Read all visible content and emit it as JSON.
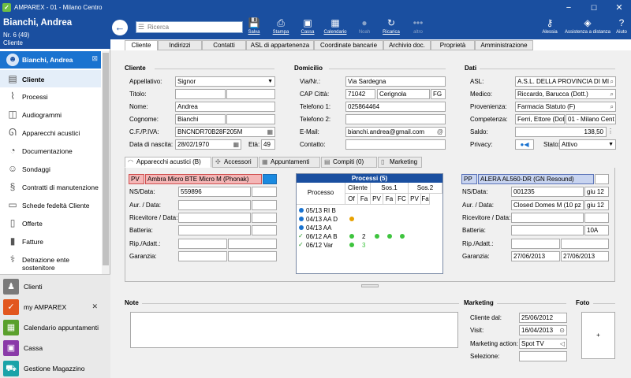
{
  "window": {
    "title": "AMPAREX - 01 - Milano Centro",
    "minimize": "−",
    "maximize": "☐",
    "close": "✕"
  },
  "patient": {
    "name": "Bianchi, Andrea",
    "number": "Nr. 6 (49)",
    "type": "Cliente"
  },
  "left_nav": {
    "header": "Bianchi, Andrea",
    "items": [
      {
        "label": "Cliente",
        "icon": "person-card-icon",
        "active": true
      },
      {
        "label": "Processi",
        "icon": "paperclip-icon"
      },
      {
        "label": "Audiogrammi",
        "icon": "audiogram-icon"
      },
      {
        "label": "Apparecchi acustici",
        "icon": "hearing-aid-icon"
      },
      {
        "label": "Documentazione",
        "icon": "document-icon"
      },
      {
        "label": "Sondaggi",
        "icon": "survey-icon"
      },
      {
        "label": "Contratti di manutenzione",
        "icon": "contract-icon"
      },
      {
        "label": "Schede fedeltà Cliente",
        "icon": "loyalty-card-icon"
      },
      {
        "label": "Offerte",
        "icon": "offer-icon"
      },
      {
        "label": "Fatture",
        "icon": "invoice-icon"
      },
      {
        "label": "Detrazione ente sostenitore",
        "icon": "deduction-icon"
      }
    ]
  },
  "bottom_nav": {
    "items": [
      {
        "label": "Clienti",
        "icon": "clients-icon",
        "color": "#7a7a7a"
      },
      {
        "label": "my AMPAREX",
        "icon": "my-amparex-icon",
        "color": "#e2571e"
      },
      {
        "label": "Calendario appuntamenti",
        "icon": "calendar-icon",
        "color": "#5aa02c"
      },
      {
        "label": "Cassa",
        "icon": "cash-register-icon",
        "color": "#8a3aa8"
      },
      {
        "label": "Gestione Magazzino",
        "icon": "warehouse-icon",
        "color": "#1aa3a8"
      }
    ]
  },
  "toolbar": {
    "search_placeholder": "Ricerca",
    "buttons": [
      {
        "label": "Salva",
        "icon": "save-icon"
      },
      {
        "label": "Stampa",
        "icon": "print-icon"
      },
      {
        "label": "Cassa",
        "icon": "cash-icon"
      },
      {
        "label": "Calendario",
        "icon": "calendar-icon"
      },
      {
        "label": "Noah",
        "icon": "noah-icon"
      },
      {
        "label": "Ricarica",
        "icon": "reload-icon"
      },
      {
        "label": "altro",
        "icon": "more-icon"
      }
    ],
    "right": [
      {
        "label": "Alessia",
        "icon": "key-icon"
      },
      {
        "label": "Assistenza a distanza",
        "icon": "remote-support-icon"
      },
      {
        "label": "Aiuto",
        "icon": "help-icon"
      }
    ]
  },
  "tabs": [
    "Cliente",
    "Indirizzi",
    "Contatti",
    "ASL di appartenenza",
    "Coordinate bancarie",
    "Archivio doc.",
    "Proprietà",
    "Amministrazione"
  ],
  "cliente": {
    "title": "Cliente",
    "appellativo_label": "Appellativo:",
    "appellativo": "Signor",
    "titolo_label": "Titolo:",
    "nome_label": "Nome:",
    "nome": "Andrea",
    "cognome_label": "Cognome:",
    "cognome": "Bianchi",
    "cf_label": "C.F./P.IVA:",
    "cf": "BNCNDR70B28F205M",
    "nascita_label": "Data di nascita:",
    "nascita": "28/02/1970",
    "eta_label": "Età:",
    "eta": "49"
  },
  "domicilio": {
    "title": "Domicilio",
    "via_label": "Via/Nr.:",
    "via": "Via Sardegna",
    "cap_label": "CAP Città:",
    "cap": "71042",
    "citta": "Cerignola",
    "prov": "FG",
    "tel1_label": "Telefono 1:",
    "tel1": "025864464",
    "tel2_label": "Telefono 2:",
    "email_label": "E-Mail:",
    "email": "bianchi.andrea@gmail.com",
    "contatto_label": "Contatto:"
  },
  "dati": {
    "title": "Dati",
    "asl_label": "ASL:",
    "asl": "A.S.L. DELLA PROVINCIA DI MI",
    "medico_label": "Medico:",
    "medico": "Riccardo, Barucca (Dott.)",
    "provenienza_label": "Provenienza:",
    "provenienza": "Farmacia Statuto (F)",
    "competenza_label": "Competenza:",
    "competenza1": "Ferri, Ettore (Dot",
    "competenza2": "01 - Milano Cent",
    "saldo_label": "Saldo:",
    "saldo": "138,50",
    "privacy_label": "Privacy:",
    "stato_label": "Stato:",
    "stato": "Attivo"
  },
  "subtabs": [
    {
      "label": "Apparecchi acustici (B)",
      "icon": "hearing-aid-icon"
    },
    {
      "label": "Accessori",
      "icon": "accessory-icon"
    },
    {
      "label": "Appuntamenti",
      "icon": "calendar-icon"
    },
    {
      "label": "Compiti (0)",
      "icon": "tasks-icon"
    },
    {
      "label": "Marketing",
      "icon": "marketing-icon"
    }
  ],
  "device_left": {
    "side": "PV",
    "model": "Ambra Micro BTE Micro M (Phonak)",
    "ns_label": "NS/Data:",
    "ns": "559896",
    "aur_label": "Aur. / Data:",
    "ricev_label": "Ricevitore / Data:",
    "batteria_label": "Batteria:",
    "rip_label": "Rip./Adatt.:",
    "garanzia_label": "Garanzia:"
  },
  "device_right": {
    "side": "PP",
    "model": "ALERA AL560-DR (GN Resound)",
    "ns_label": "NS/Data:",
    "ns": "001235",
    "ns_date": "giu 12",
    "aur_label": "Aur. / Data:",
    "aur": "Closed Domes M (10 pz",
    "aur_date": "giu 12",
    "ricev_label": "Ricevitore / Data:",
    "batteria_label": "Batteria:",
    "batteria": "10A",
    "rip_label": "Rip./Adatt.:",
    "garanzia_label": "Garanzia:",
    "garanzia1": "27/06/2013",
    "garanzia2": "27/06/2013"
  },
  "processi": {
    "title": "Processi (5)",
    "col_processo": "Processo",
    "grp_cliente": "Cliente",
    "grp_sos1": "Sos.1",
    "grp_sos2": "Sos.2",
    "sub": [
      "Of",
      "Fa",
      "PV",
      "Fa",
      "FC",
      "PV",
      "Fa"
    ],
    "rows": [
      {
        "marker": "dot-blue",
        "label": "05/13 RI B",
        "cells": [
          "",
          "",
          "",
          "",
          "",
          "",
          ""
        ]
      },
      {
        "marker": "dot-blue",
        "label": "04/13 AA D",
        "cells": [
          "orange",
          "",
          "",
          "",
          "",
          "",
          ""
        ]
      },
      {
        "marker": "dot-blue",
        "label": "04/13 AA",
        "cells": [
          "",
          "",
          "",
          "",
          "",
          "",
          ""
        ]
      },
      {
        "marker": "check",
        "label": "06/12 AA B",
        "cells": [
          "green",
          "2",
          "green",
          "green",
          "green",
          "",
          ""
        ]
      },
      {
        "marker": "check",
        "label": "06/12 Var",
        "cells": [
          "green",
          "3",
          "",
          "",
          "",
          "",
          ""
        ]
      }
    ]
  },
  "note": {
    "title": "Note"
  },
  "marketing": {
    "title": "Marketing",
    "cliente_dal_label": "Cliente dal:",
    "cliente_dal": "25/06/2012",
    "visit_label": "Visit:",
    "visit": "16/04/2013",
    "action_label": "Marketing action:",
    "action": "Spot TV",
    "selezione_label": "Selezione:"
  },
  "foto": {
    "title": "Foto",
    "add": "+"
  }
}
